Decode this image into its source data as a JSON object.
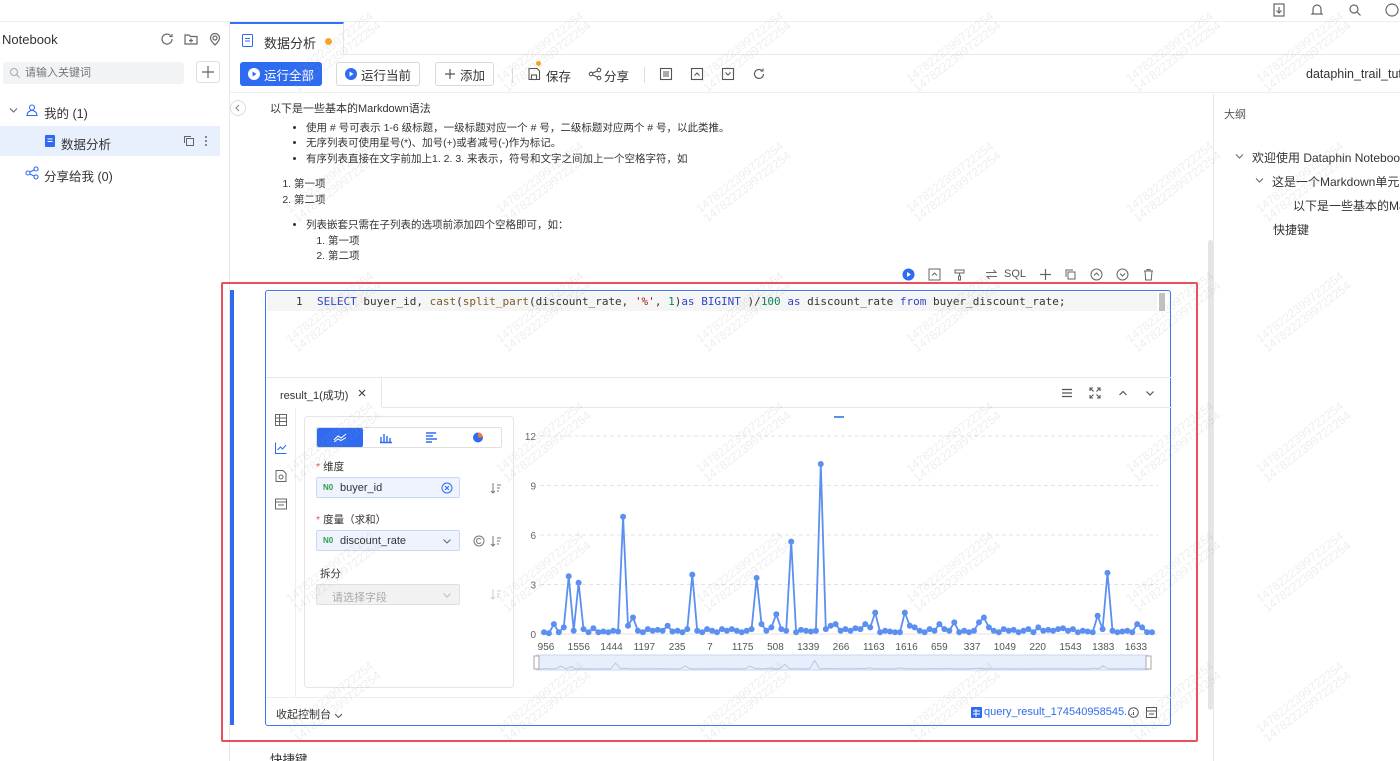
{
  "sidebar": {
    "title": "Notebook",
    "search_placeholder": "请输入关键词",
    "tree": [
      {
        "label": "我的 (1)"
      },
      {
        "label": "数据分析"
      },
      {
        "label": "分享给我 (0)"
      }
    ]
  },
  "tab": {
    "label": "数据分析",
    "unsaved_color": "#f5a623"
  },
  "toolbar": {
    "run_all": "运行全部",
    "run_current": "运行当前",
    "add": "添加",
    "save": "保存",
    "share": "分享",
    "project": "dataphin_trail_tuto"
  },
  "markdown": {
    "heading": "以下是一些基本的Markdown语法",
    "bullets": [
      "使用 # 号可表示 1-6 级标题，一级标题对应一个 # 号，二级标题对应两个 # 号，以此类推。",
      "无序列表可使用星号(*)、加号(+)或者减号(-)作为标记。",
      "有序列表直接在文字前加上1. 2. 3. 来表示，符号和文字之间加上一个空格字符，如"
    ],
    "ordered": [
      "第一项",
      "第二项"
    ],
    "nested_intro": "列表嵌套只需在子列表的选项前添加四个空格即可，如：",
    "nested": [
      "第一项",
      "第二项"
    ]
  },
  "cell": {
    "sql_label": "SQL",
    "line_number": "1",
    "code": "SELECT buyer_id, cast(split_part(discount_rate, '%', 1)as BIGINT )/100 as discount_rate from buyer_discount_rate;",
    "result_tab": "result_1(成功)",
    "config": {
      "dimension_label": "维度",
      "dimension_value": "buyer_id",
      "measure_label": "度量（求和）",
      "measure_value": "discount_rate",
      "split_label": "拆分",
      "split_placeholder": "请选择字段",
      "field_tag": "N0"
    },
    "footer_left": "收起控制台",
    "footer_right": "query_result_174540958545..."
  },
  "outline": {
    "title": "大纲",
    "items": [
      {
        "label": "欢迎使用 Dataphin Notebook"
      },
      {
        "label": "这是一个Markdown单元"
      },
      {
        "label": "以下是一些基本的Markdown"
      },
      {
        "label": "快捷键"
      }
    ]
  },
  "bottom_heading": "快捷键",
  "watermark": "1478222399722254",
  "chart_data": {
    "type": "line",
    "series_color": "#5b8ff0",
    "ylim": [
      0,
      12
    ],
    "yticks": [
      0,
      3,
      6,
      9,
      12
    ],
    "xtick_labels": [
      "956",
      "1556",
      "1444",
      "1197",
      "235",
      "7",
      "1175",
      "508",
      "1339",
      "266",
      "1163",
      "1616",
      "659",
      "337",
      "1049",
      "220",
      "1543",
      "1383",
      "1633"
    ],
    "values": [
      0.1,
      0.05,
      0.6,
      0.1,
      0.4,
      3.5,
      0.2,
      3.1,
      0.3,
      0.1,
      0.35,
      0.1,
      0.15,
      0.1,
      0.2,
      0.15,
      7.1,
      0.5,
      1.0,
      0.2,
      0.1,
      0.3,
      0.2,
      0.25,
      0.2,
      0.5,
      0.15,
      0.2,
      0.1,
      0.3,
      3.6,
      0.2,
      0.1,
      0.3,
      0.2,
      0.1,
      0.3,
      0.2,
      0.3,
      0.2,
      0.1,
      0.2,
      0.3,
      3.4,
      0.6,
      0.2,
      0.4,
      1.2,
      0.3,
      0.2,
      5.6,
      0.1,
      0.25,
      0.2,
      0.15,
      0.2,
      10.3,
      0.3,
      0.5,
      0.6,
      0.2,
      0.3,
      0.2,
      0.35,
      0.3,
      0.6,
      0.4,
      1.3,
      0.1,
      0.2,
      0.15,
      0.1,
      0.1,
      1.3,
      0.5,
      0.4,
      0.2,
      0.1,
      0.3,
      0.2,
      0.6,
      0.3,
      0.2,
      0.7,
      0.1,
      0.2,
      0.1,
      0.2,
      0.7,
      1.0,
      0.4,
      0.2,
      0.1,
      0.3,
      0.2,
      0.25,
      0.1,
      0.2,
      0.3,
      0.1,
      0.4,
      0.2,
      0.25,
      0.2,
      0.3,
      0.35,
      0.2,
      0.3,
      0.1,
      0.2,
      0.15,
      0.1,
      1.1,
      0.3,
      3.7,
      0.2,
      0.1,
      0.15,
      0.2,
      0.1,
      0.6,
      0.4,
      0.1,
      0.1
    ]
  }
}
